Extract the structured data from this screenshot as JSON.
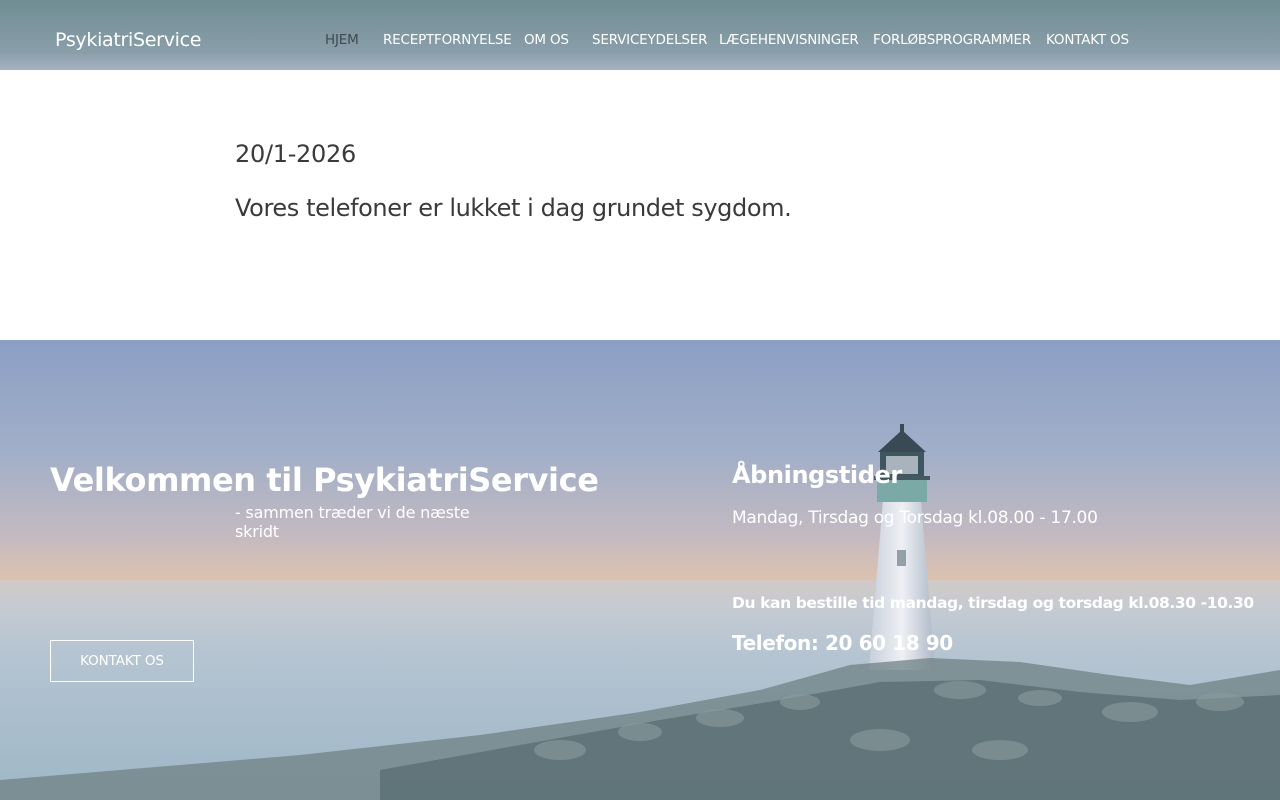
{
  "header": {
    "logo": "PsykiatriService",
    "nav": [
      {
        "label": "HJEM",
        "active": true
      },
      {
        "label": "RECEPTFORNYELSE",
        "active": false
      },
      {
        "label": "OM OS",
        "active": false
      },
      {
        "label": "SERVICEYDELSER",
        "active": false
      },
      {
        "label": "LÆGEHENVISNINGER",
        "active": false
      },
      {
        "label": "FORLØBSPROGRAMMER",
        "active": false
      },
      {
        "label": "KONTAKT OS",
        "active": false
      }
    ]
  },
  "notice": {
    "date": "20/1-2026",
    "text": "Vores telefoner er lukket i dag grundet sygdom."
  },
  "hero": {
    "title": "Velkommen til PsykiatriService",
    "subtitle": " - sammen træder vi de næste skridt",
    "button_label": "KONTAKT OS",
    "hours_title": "Åbningstider",
    "hours_text": "Mandag, Tirsdag og Torsdag kl.08.00 - 17.00",
    "booking_text": "Du kan bestille tid mandag, tirsdag og torsdag kl.08.30 -10.30",
    "phone_text": "Telefon: 20 60 18 90"
  },
  "colors": {
    "header_bg": "#7a949a",
    "active_nav": "#3e4b4f",
    "text_dark": "#3a3a3a"
  }
}
